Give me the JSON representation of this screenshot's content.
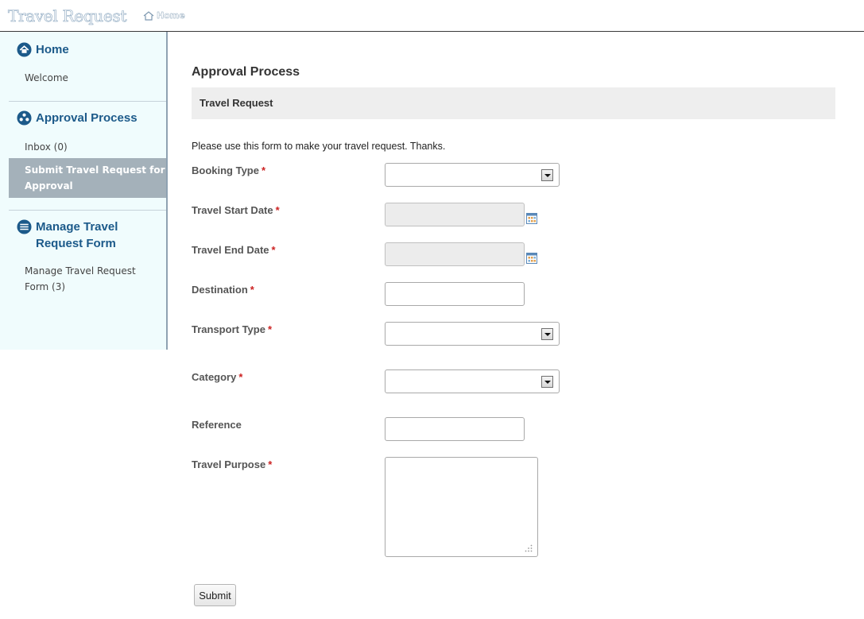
{
  "header": {
    "app_title": "Travel Request",
    "home_link": "Home"
  },
  "sidebar": {
    "home": {
      "title": "Home",
      "items": [
        "Welcome"
      ]
    },
    "approval": {
      "title": "Approval Process",
      "items": [
        "Inbox (0)",
        "Submit Travel Request for Approval"
      ]
    },
    "manage": {
      "title": "Manage Travel Request Form",
      "items": [
        "Manage Travel Request Form (3)"
      ]
    }
  },
  "main": {
    "heading": "Approval Process",
    "section_title": "Travel Request",
    "intro": "Please use this form to make your travel request. Thanks.",
    "required_marker": "*",
    "fields": {
      "booking_type": "Booking Type",
      "travel_start_date": "Travel Start Date",
      "travel_end_date": "Travel End Date",
      "destination": "Destination",
      "transport_type": "Transport Type",
      "category": "Category",
      "reference": "Reference",
      "travel_purpose": "Travel Purpose"
    },
    "submit_label": "Submit"
  },
  "colors": {
    "accent": "#1c5a8a",
    "sidebar_bg": "#f0fcfd",
    "active_item_bg": "#a4b1ba",
    "required": "#cc2222"
  }
}
